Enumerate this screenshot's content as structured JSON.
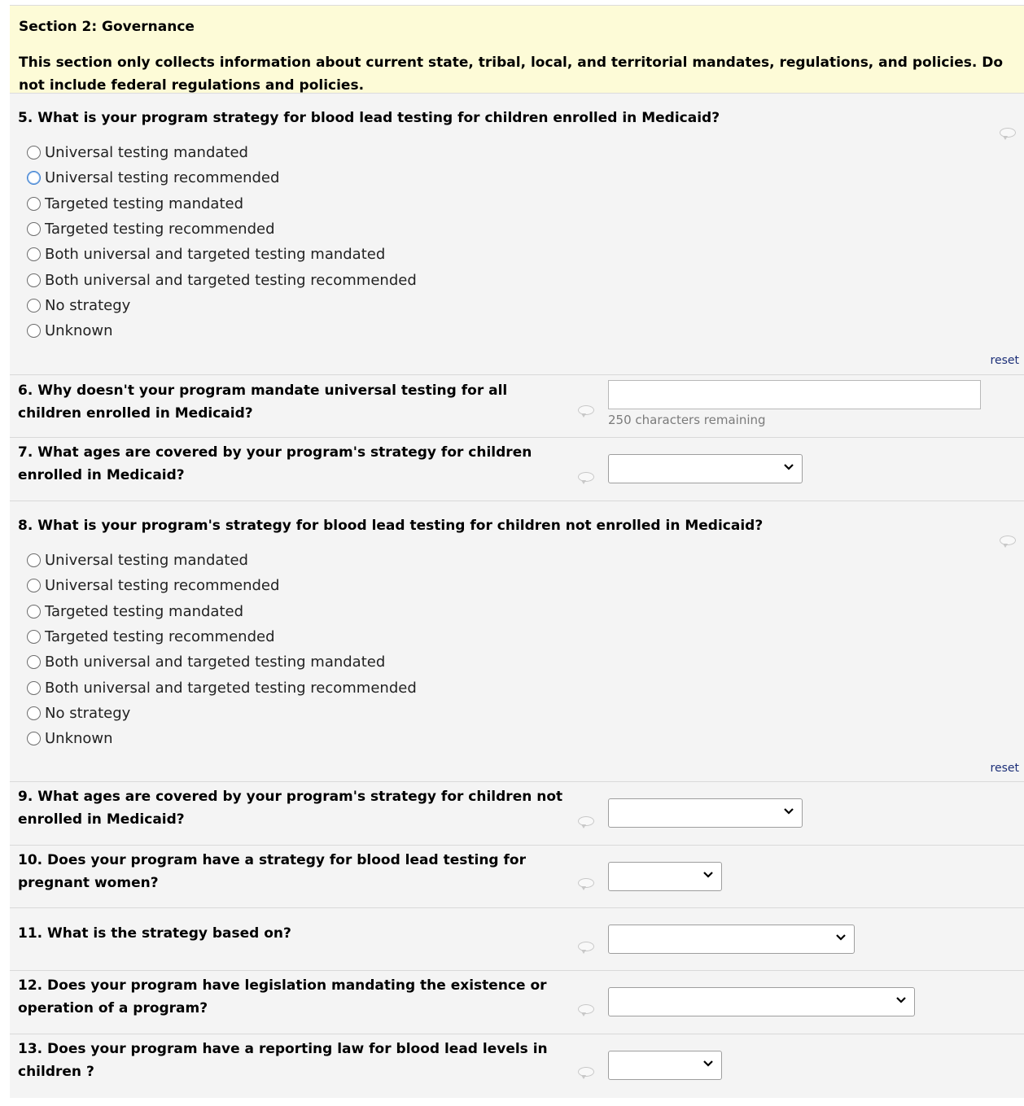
{
  "section": {
    "title": "Section 2: Governance",
    "description": "This section only collects information about current state, tribal, local, and territorial mandates, regulations, and policies. Do not include federal regulations and policies."
  },
  "reset_label": "reset",
  "q5": {
    "label": "5. What is your program strategy for blood lead testing for children enrolled in Medicaid?",
    "options": [
      "Universal testing mandated",
      "Universal testing recommended",
      "Targeted testing mandated",
      "Targeted testing recommended",
      "Both universal and targeted testing mandated",
      "Both universal and targeted testing recommended",
      "No strategy",
      "Unknown"
    ]
  },
  "q6": {
    "label": "6. Why doesn't your program mandate universal testing for all children enrolled in Medicaid?",
    "value": "",
    "remaining": "250 characters remaining"
  },
  "q7": {
    "label": "7. What ages are covered by your program's strategy for children enrolled in Medicaid?",
    "value": ""
  },
  "q8": {
    "label": "8. What is your program's strategy for blood lead testing for children not enrolled in Medicaid?",
    "options": [
      "Universal testing mandated",
      "Universal testing recommended",
      "Targeted testing mandated",
      "Targeted testing recommended",
      "Both universal and targeted testing mandated",
      "Both universal and targeted testing recommended",
      "No strategy",
      "Unknown"
    ]
  },
  "q9": {
    "label": "9. What ages are covered by your program's strategy for children not enrolled in Medicaid?",
    "value": ""
  },
  "q10": {
    "label": "10. Does your program have a strategy for blood lead testing for pregnant women?",
    "value": ""
  },
  "q11": {
    "label": "11. What is the strategy based on?",
    "value": ""
  },
  "q12": {
    "label": "12. Does your program have legislation mandating the existence or operation of a program?",
    "value": ""
  },
  "q13": {
    "label": "13. Does your program have a reporting law for blood lead levels in children ?",
    "value": ""
  }
}
